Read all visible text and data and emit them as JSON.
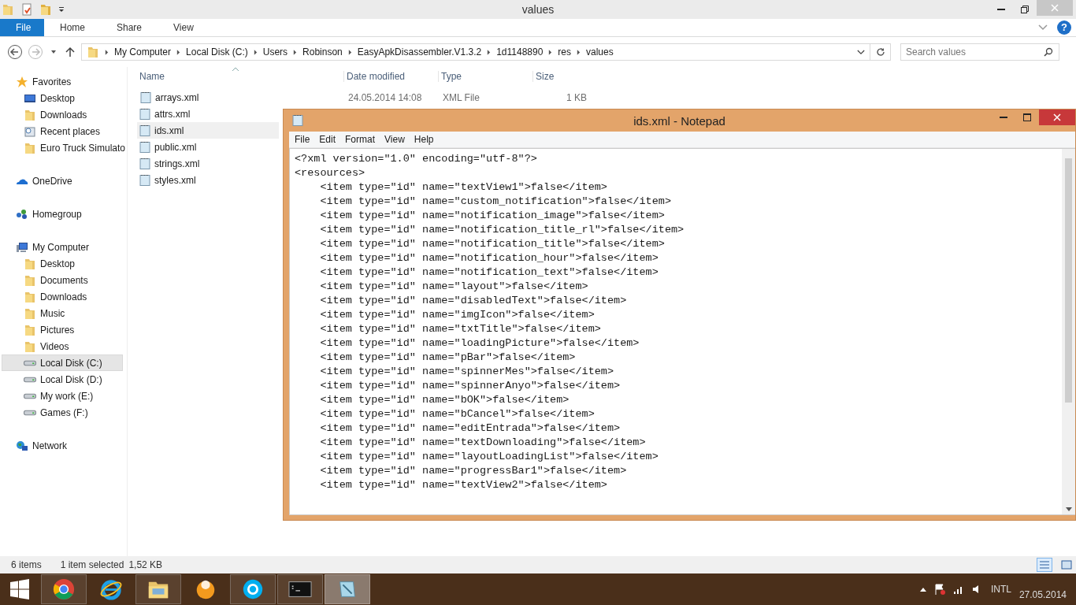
{
  "explorer": {
    "title": "values",
    "ribbon_tabs": [
      {
        "label": "File",
        "selected": true
      },
      {
        "label": "Home",
        "selected": false
      },
      {
        "label": "Share",
        "selected": false
      },
      {
        "label": "View",
        "selected": false
      }
    ],
    "breadcrumbs": [
      "My Computer",
      "Local Disk (C:)",
      "Users",
      "Robinson",
      "EasyApkDisassembler.V1.3.2",
      "1d1148890",
      "res",
      "values"
    ],
    "search": {
      "placeholder": "Search values"
    },
    "help_button": "?",
    "sidebar": [
      {
        "label": "Favorites",
        "kind": "star",
        "selected": false,
        "children": [
          {
            "label": "Desktop",
            "kind": "desktop",
            "selected": false
          },
          {
            "label": "Downloads",
            "kind": "folder",
            "selected": false
          },
          {
            "label": "Recent places",
            "kind": "recent",
            "selected": false
          },
          {
            "label": "Euro Truck Simulato",
            "kind": "folder",
            "selected": false
          }
        ]
      },
      {
        "label": "OneDrive",
        "kind": "cloud",
        "selected": false
      },
      {
        "label": "Homegroup",
        "kind": "homegroup",
        "selected": false
      },
      {
        "label": "My Computer",
        "kind": "computer",
        "selected": false,
        "children": [
          {
            "label": "Desktop",
            "kind": "folder",
            "selected": false
          },
          {
            "label": "Documents",
            "kind": "folder",
            "selected": false
          },
          {
            "label": "Downloads",
            "kind": "folder",
            "selected": false
          },
          {
            "label": "Music",
            "kind": "folder",
            "selected": false
          },
          {
            "label": "Pictures",
            "kind": "folder",
            "selected": false
          },
          {
            "label": "Videos",
            "kind": "folder",
            "selected": false
          },
          {
            "label": "Local Disk (C:)",
            "kind": "drive",
            "selected": true
          },
          {
            "label": "Local Disk (D:)",
            "kind": "drive",
            "selected": false
          },
          {
            "label": "My work (E:)",
            "kind": "drive",
            "selected": false
          },
          {
            "label": "Games (F:)",
            "kind": "drive",
            "selected": false
          }
        ]
      },
      {
        "label": "Network",
        "kind": "network",
        "selected": false
      }
    ],
    "columns": [
      "Name",
      "Date modified",
      "Type",
      "Size"
    ],
    "files": [
      {
        "name": "arrays.xml",
        "date": "24.05.2014 14:08",
        "type": "XML File",
        "size": "1 KB",
        "selected": false
      },
      {
        "name": "attrs.xml",
        "selected": false
      },
      {
        "name": "ids.xml",
        "selected": true
      },
      {
        "name": "public.xml",
        "selected": false
      },
      {
        "name": "strings.xml",
        "selected": false
      },
      {
        "name": "styles.xml",
        "selected": false
      }
    ],
    "status_bar": {
      "count": "6 items",
      "selection": "1 item selected",
      "size": "1,52 KB"
    }
  },
  "notepad": {
    "title": "ids.xml - Notepad",
    "menu": [
      "File",
      "Edit",
      "Format",
      "View",
      "Help"
    ],
    "lines": [
      "<?xml version=\"1.0\" encoding=\"utf-8\"?>",
      "<resources>",
      "    <item type=\"id\" name=\"textView1\">false</item>",
      "    <item type=\"id\" name=\"custom_notification\">false</item>",
      "    <item type=\"id\" name=\"notification_image\">false</item>",
      "    <item type=\"id\" name=\"notification_title_rl\">false</item>",
      "    <item type=\"id\" name=\"notification_title\">false</item>",
      "    <item type=\"id\" name=\"notification_hour\">false</item>",
      "    <item type=\"id\" name=\"notification_text\">false</item>",
      "    <item type=\"id\" name=\"layout\">false</item>",
      "    <item type=\"id\" name=\"disabledText\">false</item>",
      "    <item type=\"id\" name=\"imgIcon\">false</item>",
      "    <item type=\"id\" name=\"txtTitle\">false</item>",
      "    <item type=\"id\" name=\"loadingPicture\">false</item>",
      "    <item type=\"id\" name=\"pBar\">false</item>",
      "    <item type=\"id\" name=\"spinnerMes\">false</item>",
      "    <item type=\"id\" name=\"spinnerAnyo\">false</item>",
      "    <item type=\"id\" name=\"bOK\">false</item>",
      "    <item type=\"id\" name=\"bCancel\">false</item>",
      "    <item type=\"id\" name=\"editEntrada\">false</item>",
      "    <item type=\"id\" name=\"textDownloading\">false</item>",
      "    <item type=\"id\" name=\"layoutLoadingList\">false</item>",
      "    <item type=\"id\" name=\"progressBar1\">false</item>",
      "    <item type=\"id\" name=\"textView2\">false</item>"
    ]
  },
  "taskbar": {
    "apps": [
      {
        "kind": "chrome",
        "running": true,
        "selected": false
      },
      {
        "kind": "ie",
        "running": false,
        "selected": false
      },
      {
        "kind": "explorer",
        "running": true,
        "selected": false
      },
      {
        "kind": "orange",
        "running": false,
        "selected": false
      },
      {
        "kind": "skype",
        "running": true,
        "selected": false
      },
      {
        "kind": "cmd",
        "running": true,
        "selected": false
      },
      {
        "kind": "notepad",
        "running": true,
        "selected": true
      }
    ],
    "language": "INTL",
    "date": "27.05.2014"
  }
}
